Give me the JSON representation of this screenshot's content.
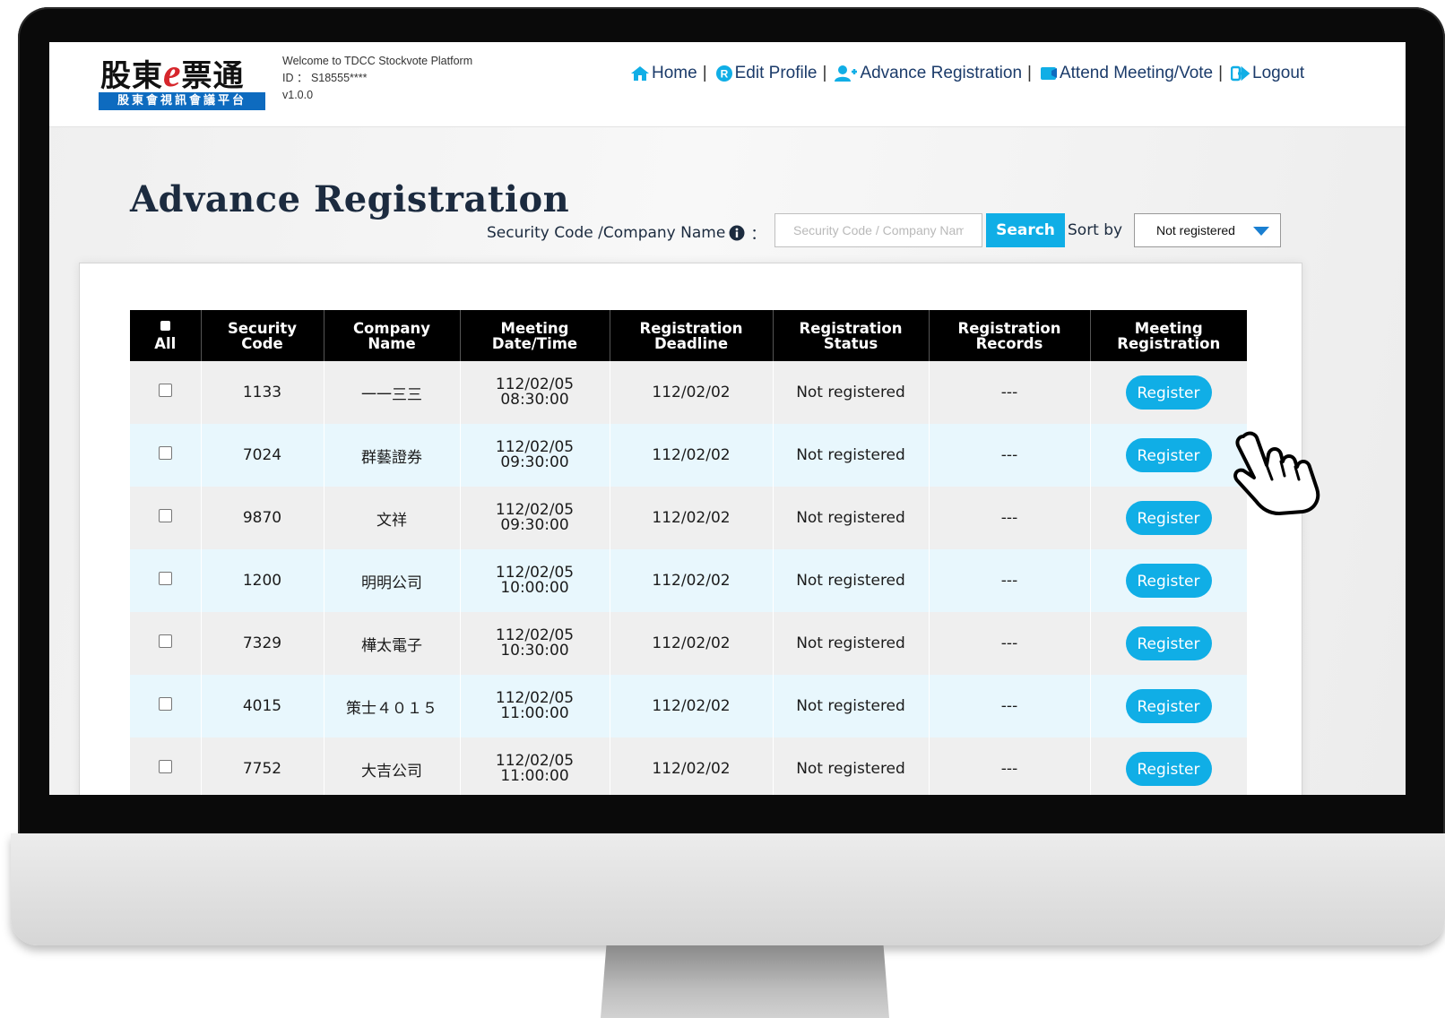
{
  "header": {
    "logo_text_left": "股東",
    "logo_text_e": "e",
    "logo_text_right": "票通",
    "logo_subtitle": "股東會視訊會議平台",
    "welcome_line1": "Welcome to TDCC Stockvote Platform",
    "welcome_line2": "ID ： S18555****",
    "welcome_line3": "v1.0.0"
  },
  "nav": {
    "home": "Home",
    "edit_profile": "Edit Profile",
    "advance_registration": "Advance Registration",
    "attend_meeting": "Attend Meeting/Vote",
    "logout": "Logout",
    "separator": "|",
    "accent_color": "#1b3b6a"
  },
  "page": {
    "title": "Advance Registration",
    "search_label": "Security Code /Company Name",
    "search_colon": "：",
    "search_placeholder": "Security Code / Company Name",
    "search_value": "",
    "search_button": "Search",
    "sort_label": "Sort by",
    "sort_value": "Not registered"
  },
  "table": {
    "headers": {
      "all": "All",
      "security_code": "Security Code",
      "company_name": "Company Name",
      "meeting_datetime_1": "Meeting",
      "meeting_datetime_2": "Date/Time",
      "deadline_1": "Registration",
      "deadline_2": "Deadline",
      "status_1": "Registration",
      "status_2": "Status",
      "records_1": "Registration",
      "records_2": "Records",
      "meeting_reg_1": "Meeting",
      "meeting_reg_2": "Registration",
      "security_1": "Security",
      "security_2": "Code",
      "company_1": "Company",
      "company_2": "Name"
    },
    "rows": [
      {
        "code": "1133",
        "name": "一一三三",
        "date": "112/02/05",
        "time": "08:30:00",
        "deadline": "112/02/02",
        "status": "Not registered",
        "records": "---",
        "action": "Register"
      },
      {
        "code": "7024",
        "name": "群藝證券",
        "date": "112/02/05",
        "time": "09:30:00",
        "deadline": "112/02/02",
        "status": "Not registered",
        "records": "---",
        "action": "Register"
      },
      {
        "code": "9870",
        "name": "文祥",
        "date": "112/02/05",
        "time": "09:30:00",
        "deadline": "112/02/02",
        "status": "Not registered",
        "records": "---",
        "action": "Register"
      },
      {
        "code": "1200",
        "name": "明明公司",
        "date": "112/02/05",
        "time": "10:00:00",
        "deadline": "112/02/02",
        "status": "Not registered",
        "records": "---",
        "action": "Register"
      },
      {
        "code": "7329",
        "name": "樺太電子",
        "date": "112/02/05",
        "time": "10:30:00",
        "deadline": "112/02/02",
        "status": "Not registered",
        "records": "---",
        "action": "Register"
      },
      {
        "code": "4015",
        "name": "策士４０１５",
        "date": "112/02/05",
        "time": "11:00:00",
        "deadline": "112/02/02",
        "status": "Not registered",
        "records": "---",
        "action": "Register"
      },
      {
        "code": "7752",
        "name": "大吉公司",
        "date": "112/02/05",
        "time": "11:00:00",
        "deadline": "112/02/02",
        "status": "Not registered",
        "records": "---",
        "action": "Register"
      }
    ]
  },
  "colors": {
    "button": "#10aee6",
    "header_bg": "#000000",
    "row_odd": "#efefef",
    "row_even": "#e8f7fd"
  },
  "icons": [
    "home-icon",
    "edit-profile-icon",
    "add-user-icon",
    "meeting-icon",
    "logout-icon",
    "info-icon",
    "hand-pointer-icon",
    "caret-down-icon"
  ]
}
